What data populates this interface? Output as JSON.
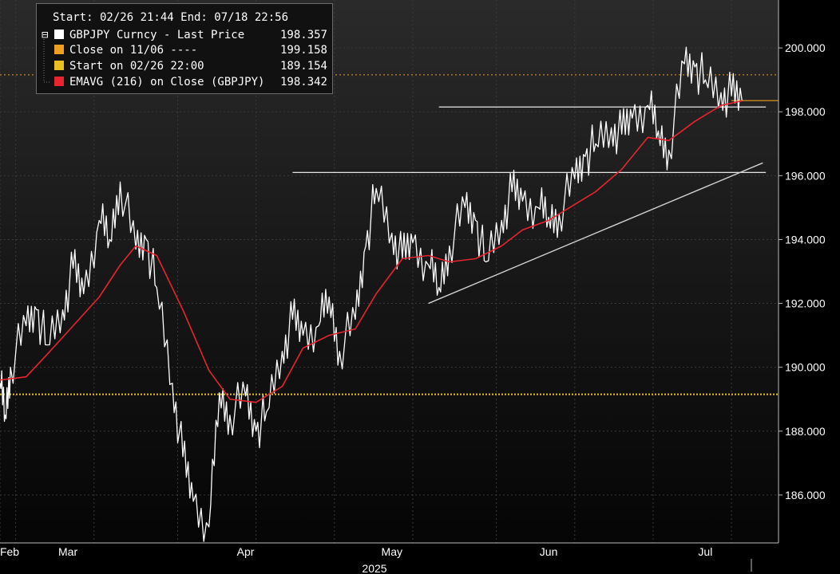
{
  "colors": {
    "background_top": "#2a2a2a",
    "background_bottom": "#050505",
    "grid": "#3a3a3a",
    "price": "#ffffff",
    "ema": "#e8242f",
    "close_line": "#f0a020",
    "start_line": "#e8c020",
    "trend_lines": "#ffffff"
  },
  "legend": {
    "header": "Start: 02/26 21:44 End: 07/18 22:56",
    "rows": [
      {
        "label": "GBPJPY Curncy - Last Price",
        "value": "198.357",
        "color": "#ffffff"
      },
      {
        "label": "Close on 11/06 ----",
        "value": "199.158",
        "color": "#f0a020"
      },
      {
        "label": "Start on 02/26 22:00",
        "value": "189.154",
        "color": "#e8c020"
      },
      {
        "label": "EMAVG (216)  on Close (GBPJPY)",
        "value": "198.342",
        "color": "#e8242f"
      }
    ]
  },
  "chart_data": {
    "type": "line",
    "title": "",
    "xlabel": "2025",
    "ylabel": "",
    "x_ticks": [
      "Feb",
      "Mar",
      "Apr",
      "May",
      "Jun",
      "Jul"
    ],
    "y_ticks": [
      "186.000",
      "188.000",
      "190.000",
      "192.000",
      "194.000",
      "196.000",
      "198.000",
      "200.000"
    ],
    "ylim": [
      184.5,
      201.5
    ],
    "xlim": [
      "2025-02-26",
      "2025-07-25"
    ],
    "grid": true,
    "legend_position": "top-left",
    "series": [
      {
        "name": "GBPJPY Curncy - Last Price",
        "x": [
          "2025-02-26",
          "2025-02-27",
          "2025-02-28",
          "2025-03-03",
          "2025-03-05",
          "2025-03-07",
          "2025-03-10",
          "2025-03-12",
          "2025-03-14",
          "2025-03-17",
          "2025-03-19",
          "2025-03-21",
          "2025-03-24",
          "2025-03-26",
          "2025-03-28",
          "2025-03-31",
          "2025-04-02",
          "2025-04-04",
          "2025-04-07",
          "2025-04-09",
          "2025-04-11",
          "2025-04-14",
          "2025-04-16",
          "2025-04-18",
          "2025-04-21",
          "2025-04-23",
          "2025-04-25",
          "2025-04-28",
          "2025-04-30",
          "2025-05-02",
          "2025-05-05",
          "2025-05-07",
          "2025-05-09",
          "2025-05-12",
          "2025-05-14",
          "2025-05-16",
          "2025-05-19",
          "2025-05-21",
          "2025-05-23",
          "2025-05-26",
          "2025-05-28",
          "2025-05-30",
          "2025-06-02",
          "2025-06-04",
          "2025-06-06",
          "2025-06-09",
          "2025-06-11",
          "2025-06-13",
          "2025-06-16",
          "2025-06-18",
          "2025-06-20",
          "2025-06-23",
          "2025-06-25",
          "2025-06-27",
          "2025-06-30",
          "2025-07-02",
          "2025-07-04",
          "2025-07-07",
          "2025-07-09",
          "2025-07-11",
          "2025-07-14",
          "2025-07-16",
          "2025-07-18"
        ],
        "values": [
          189.5,
          188.5,
          190.0,
          191.3,
          191.8,
          190.7,
          191.8,
          193.1,
          192.3,
          194.6,
          194.0,
          195.8,
          193.7,
          194.0,
          192.5,
          189.5,
          187.2,
          185.8,
          185.0,
          189.2,
          188.5,
          189.1,
          188.0,
          188.6,
          190.5,
          191.5,
          191.0,
          191.3,
          192.2,
          190.5,
          191.5,
          193.8,
          195.6,
          194.2,
          193.4,
          193.9,
          193.2,
          192.5,
          193.8,
          195.0,
          194.6,
          193.3,
          194.6,
          195.5,
          195.2,
          195.0,
          194.7,
          194.8,
          195.9,
          196.6,
          197.0,
          197.5,
          197.3,
          197.8,
          198.2,
          197.4,
          196.8,
          199.5,
          199.4,
          199.0,
          198.6,
          198.5,
          198.357
        ]
      },
      {
        "name": "EMAVG (216)  on Close (GBPJPY)",
        "x": [
          "2025-02-26",
          "2025-03-03",
          "2025-03-07",
          "2025-03-12",
          "2025-03-17",
          "2025-03-21",
          "2025-03-24",
          "2025-03-28",
          "2025-04-02",
          "2025-04-07",
          "2025-04-11",
          "2025-04-16",
          "2025-04-21",
          "2025-04-25",
          "2025-04-30",
          "2025-05-05",
          "2025-05-09",
          "2025-05-14",
          "2025-05-19",
          "2025-05-23",
          "2025-05-28",
          "2025-06-02",
          "2025-06-06",
          "2025-06-11",
          "2025-06-16",
          "2025-06-20",
          "2025-06-25",
          "2025-06-30",
          "2025-07-04",
          "2025-07-09",
          "2025-07-14",
          "2025-07-18"
        ],
        "values": [
          189.6,
          189.7,
          190.4,
          191.3,
          192.2,
          193.2,
          193.8,
          193.5,
          191.8,
          189.9,
          189.0,
          188.9,
          189.4,
          190.6,
          191.0,
          191.2,
          192.3,
          193.4,
          193.5,
          193.3,
          193.4,
          193.8,
          194.3,
          194.6,
          195.1,
          195.5,
          196.2,
          197.2,
          197.1,
          197.7,
          198.2,
          198.342
        ]
      }
    ],
    "reference_lines": [
      {
        "name": "Close on 11/06",
        "value": 199.158
      },
      {
        "name": "Start on 02/26 22:00",
        "value": 189.154
      }
    ],
    "annotations": [
      {
        "kind": "horizontal",
        "value": 196.1,
        "from": "2025-04-23",
        "to": "2025-07-18"
      },
      {
        "kind": "horizontal",
        "value": 198.15,
        "from": "2025-05-21",
        "to": "2025-07-18"
      },
      {
        "kind": "trendline",
        "from": [
          "2025-05-19",
          192.0
        ],
        "to": [
          "2025-07-22",
          196.4
        ]
      }
    ]
  }
}
